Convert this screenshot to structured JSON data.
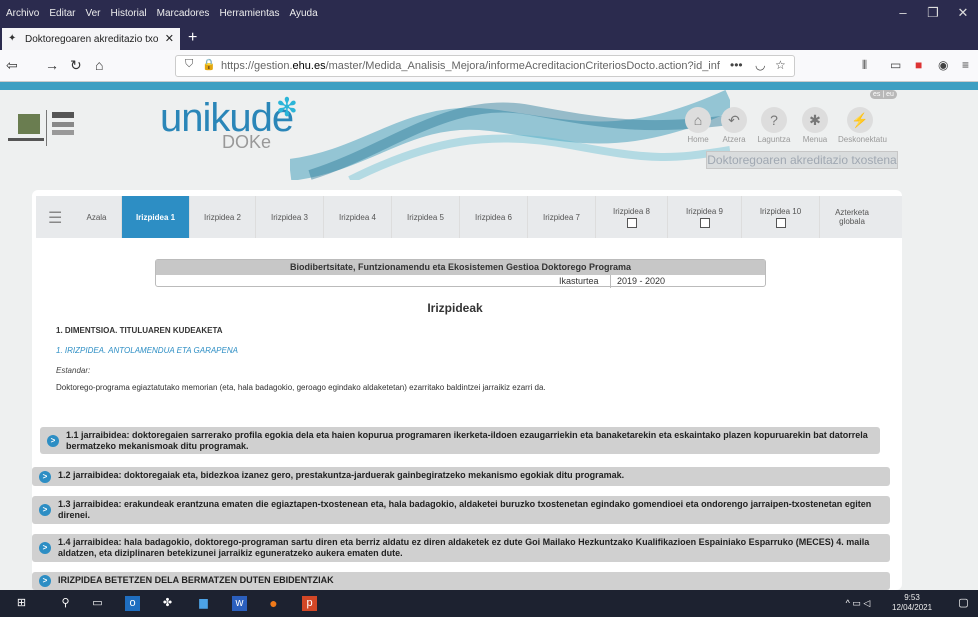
{
  "menubar": {
    "items": [
      "Archivo",
      "Editar",
      "Ver",
      "Historial",
      "Marcadores",
      "Herramientas",
      "Ayuda"
    ]
  },
  "browser": {
    "tab_title": "Doktoregoaren akreditazio txo",
    "url_prefix": "https://gestion.",
    "url_domain": "ehu.es",
    "url_path": "/master/Medida_Analisis_Mejora/informeAcreditacionCriteriosDocto.action?id_inf"
  },
  "header": {
    "brand": "unikude",
    "brand_sub": "DOKe",
    "logo_text": "Universidad del País Vasco / Euskal Herriko Unibertsitatea",
    "icons": [
      {
        "label": "Home",
        "icon": "home-icon"
      },
      {
        "label": "Atzera",
        "icon": "back-icon"
      },
      {
        "label": "Laguntza",
        "icon": "help-icon"
      },
      {
        "label": "Menua",
        "icon": "menu-icon"
      },
      {
        "label": "Deskonektatu",
        "icon": "disconnect-icon"
      }
    ],
    "doc_title": "Doktoregoaren akreditazio txostena",
    "langs": "es | eu"
  },
  "tabs": [
    {
      "label": "Azala"
    },
    {
      "label": "Irizpidea 1",
      "active": true
    },
    {
      "label": "Irizpidea 2"
    },
    {
      "label": "Irizpidea 3"
    },
    {
      "label": "Irizpidea 4"
    },
    {
      "label": "Irizpidea 5"
    },
    {
      "label": "Irizpidea 6"
    },
    {
      "label": "Irizpidea 7"
    },
    {
      "label": "Irizpidea 8",
      "checkbox": true
    },
    {
      "label": "Irizpidea 9",
      "checkbox": true
    },
    {
      "label": "Irizpidea 10",
      "checkbox": true
    },
    {
      "label": "Azterketa globala"
    }
  ],
  "program": {
    "title": "Biodibertsitate, Funtzionamendu eta Ekosistemen Gestioa Doktorego Programa",
    "year_label": "Ikasturtea",
    "year_value": "2019 - 2020"
  },
  "content": {
    "heading": "Irizpideak",
    "dimension": "1. DIMENTSIOA. TITULUAREN KUDEAKETA",
    "criterion": "1. IRIZPIDEA. ANTOLAMENDUA ETA GARAPENA",
    "standard_label": "Estandar:",
    "standard_text": "Doktorego-programa egiaztatutako memorian (eta, hala badagokio, geroago egindako aldaketetan) ezarritako baldintzei jarraikiz ezarri da."
  },
  "accordions": [
    "1.1 jarraibidea: doktoregaien sarrerako profila egokia dela eta haien kopurua programaren ikerketa-ildoen ezaugarriekin eta banaketarekin eta eskaintako plazen kopuruarekin bat datorrela bermatzeko mekanismoak ditu programak.",
    "1.2 jarraibidea: doktoregaiak eta, bidezkoa izanez gero, prestakuntza-jarduerak gainbegiratzeko mekanismo egokiak ditu programak.",
    "1.3 jarraibidea: erakundeak erantzuna ematen die egiaztapen-txostenean eta, hala badagokio, aldaketei buruzko txostenetan egindako gomendioei eta ondorengo jarraipen-txostenetan egiten direnei.",
    "1.4 jarraibidea: hala badagokio, doktorego-programan sartu diren eta berriz aldatu ez diren aldaketek ez dute Goi Mailako Hezkuntzako Kualifikazioen Espainiako Esparruko (MECES) 4. maila aldatzen, eta diziplinaren betekizunei jarraikiz eguneratzeko aukera ematen dute.",
    "IRIZPIDEA BETETZEN DELA BERMATZEN DUTEN EBIDENTZIAK"
  ],
  "taskbar": {
    "time": "9:53",
    "date": "12/04/2021"
  }
}
